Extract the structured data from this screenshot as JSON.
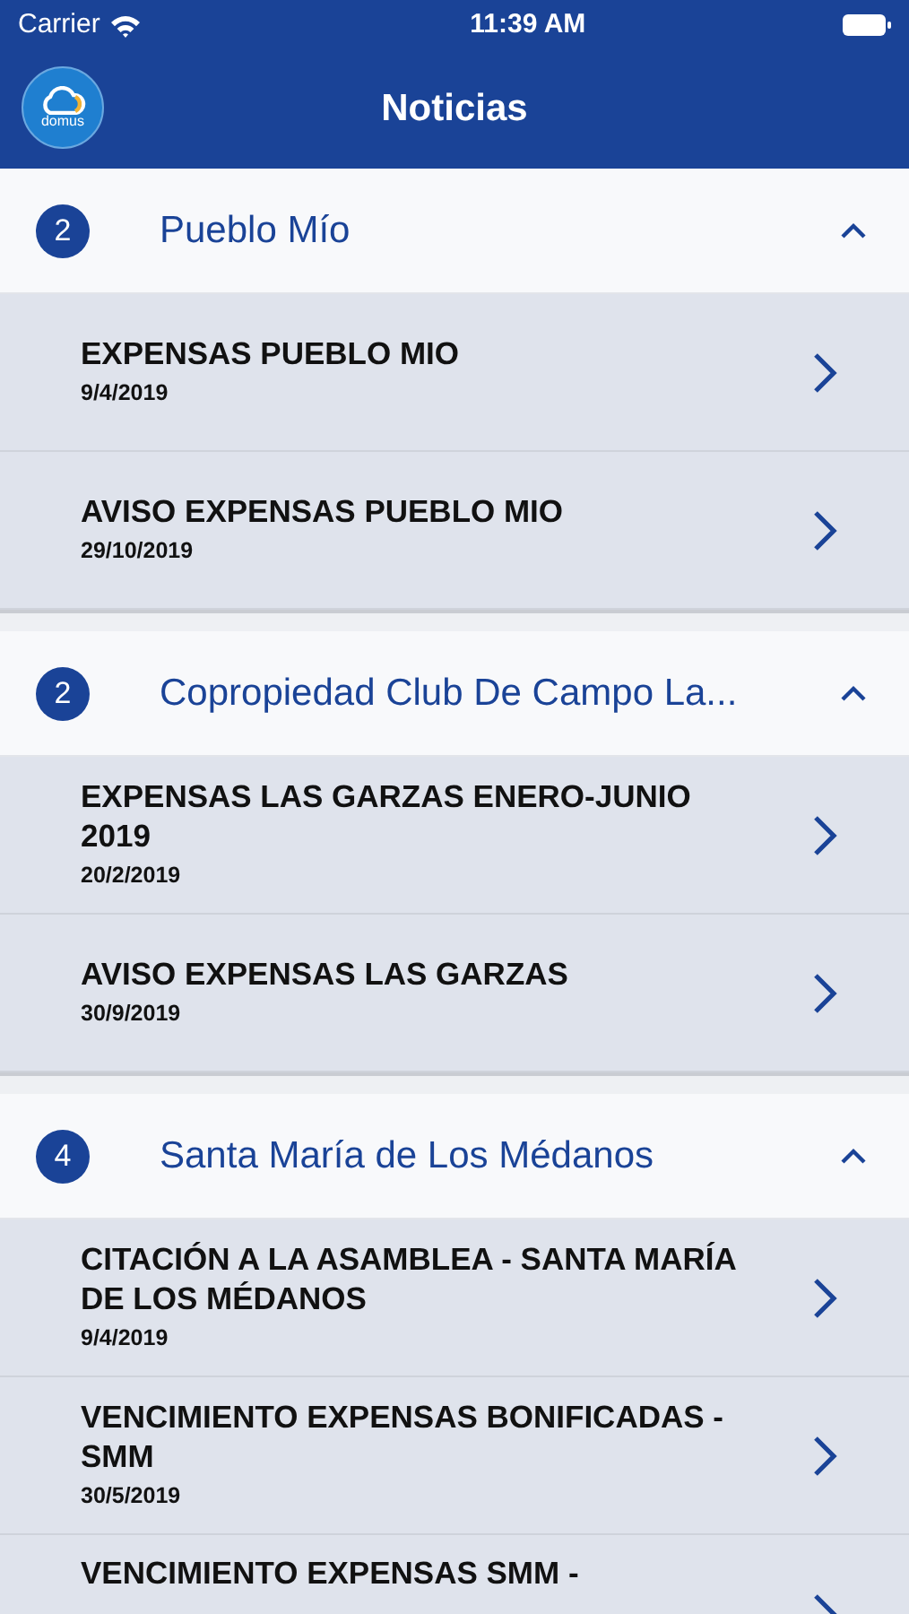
{
  "status_bar": {
    "carrier": "Carrier",
    "time": "11:39 AM"
  },
  "nav": {
    "logo_text": "domus",
    "title": "Noticias"
  },
  "groups": [
    {
      "count": "2",
      "name": "Pueblo Mío",
      "expanded": true,
      "items": [
        {
          "title": "EXPENSAS PUEBLO MIO",
          "date": "9/4/2019"
        },
        {
          "title": "AVISO EXPENSAS PUEBLO MIO",
          "date": "29/10/2019"
        }
      ]
    },
    {
      "count": "2",
      "name": "Copropiedad Club De Campo La...",
      "expanded": true,
      "items": [
        {
          "title": "EXPENSAS  LAS GARZAS ENERO-JUNIO 2019",
          "date": "20/2/2019"
        },
        {
          "title": "AVISO EXPENSAS LAS GARZAS",
          "date": "30/9/2019"
        }
      ]
    },
    {
      "count": "4",
      "name": "Santa María de Los Médanos",
      "expanded": true,
      "items": [
        {
          "title": "CITACIÓN A LA ASAMBLEA - SANTA MARÍA DE LOS MÉDANOS",
          "date": "9/4/2019"
        },
        {
          "title": "VENCIMIENTO EXPENSAS BONIFICADAS - SMM",
          "date": "30/5/2019"
        },
        {
          "title": "VENCIMIENTO EXPENSAS SMM -"
        }
      ]
    }
  ]
}
